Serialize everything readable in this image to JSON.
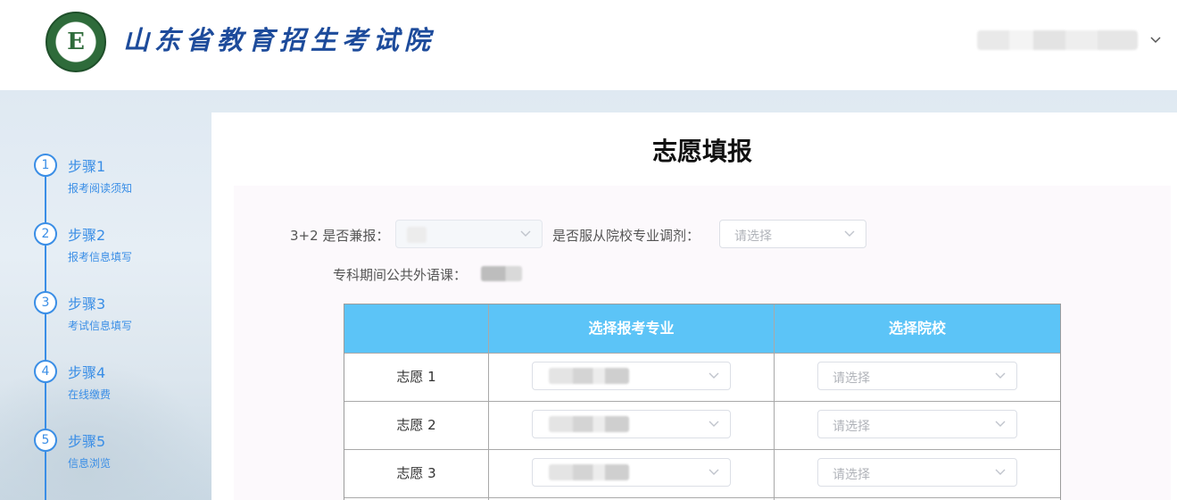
{
  "header": {
    "org_name": "山东省教育招生考试院",
    "logo_letter": "E"
  },
  "steps": [
    {
      "num": "1",
      "title": "步骤1",
      "sub": "报考阅读须知"
    },
    {
      "num": "2",
      "title": "步骤2",
      "sub": "报考信息填写"
    },
    {
      "num": "3",
      "title": "步骤3",
      "sub": "考试信息填写"
    },
    {
      "num": "4",
      "title": "步骤4",
      "sub": "在线缴费"
    },
    {
      "num": "5",
      "title": "步骤5",
      "sub": "信息浏览"
    }
  ],
  "main": {
    "title": "志愿填报",
    "form": {
      "dual_label": "3+2 是否兼报：",
      "adjust_label": "是否服从院校专业调剂：",
      "adjust_placeholder": "请选择",
      "language_label": "专科期间公共外语课："
    },
    "table": {
      "headers": [
        "",
        "选择报考专业",
        "选择院校"
      ],
      "rows": [
        {
          "label": "志愿 1",
          "school_placeholder": "请选择"
        },
        {
          "label": "志愿 2",
          "school_placeholder": "请选择"
        },
        {
          "label": "志愿 3",
          "school_placeholder": "请选择"
        }
      ]
    }
  },
  "colors": {
    "accent": "#3a8ee6",
    "table_header": "#5cc4f7",
    "brand_title": "#1d4b9b"
  }
}
